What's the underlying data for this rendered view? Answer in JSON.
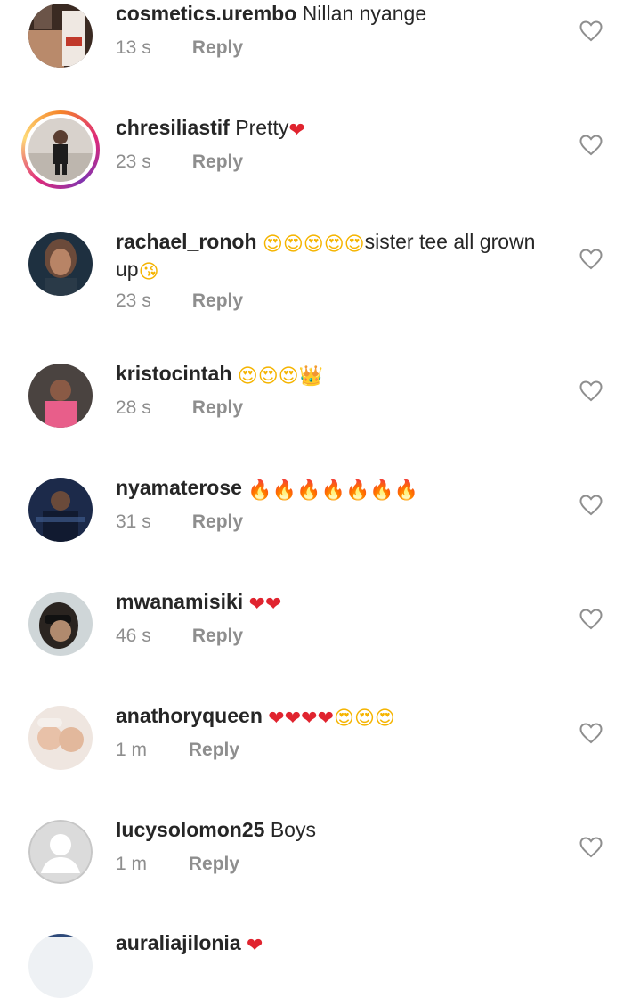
{
  "comments": [
    {
      "username": "cosmetics.urembo",
      "body": "Nillan nyange",
      "time": "13 s",
      "reply": "Reply",
      "avatar": "product-photo"
    },
    {
      "username": "chresiliastif",
      "body": "Pretty❤",
      "time": "23 s",
      "reply": "Reply",
      "avatar": "person-photo-story-ring"
    },
    {
      "username": "rachael_ronoh",
      "body": "😍😍😍😍😍sister tee all grown up😘",
      "time": "23 s",
      "reply": "Reply",
      "avatar": "person-photo"
    },
    {
      "username": "kristocintah",
      "body": "😍😍😍👑",
      "time": "28 s",
      "reply": "Reply",
      "avatar": "person-photo"
    },
    {
      "username": "nyamaterose",
      "body": "🔥🔥🔥🔥🔥🔥🔥",
      "time": "31 s",
      "reply": "Reply",
      "avatar": "person-photo"
    },
    {
      "username": "mwanamisiki",
      "body": "❤❤",
      "time": "46 s",
      "reply": "Reply",
      "avatar": "person-photo"
    },
    {
      "username": "anathoryqueen",
      "body": "❤❤❤❤😍😍😍",
      "time": "1 m",
      "reply": "Reply",
      "avatar": "babies-photo"
    },
    {
      "username": "lucysolomon25",
      "body": "Boys",
      "time": "1 m",
      "reply": "Reply",
      "avatar": "default-avatar"
    },
    {
      "username": "auraliajilonia",
      "body": "❤",
      "time": "",
      "reply": "",
      "avatar": "person-photo"
    }
  ],
  "icons": {
    "like": "heart-outline-icon"
  },
  "colors": {
    "text": "#262626",
    "secondary": "#8e8e8e",
    "heart": "#e0242f"
  }
}
